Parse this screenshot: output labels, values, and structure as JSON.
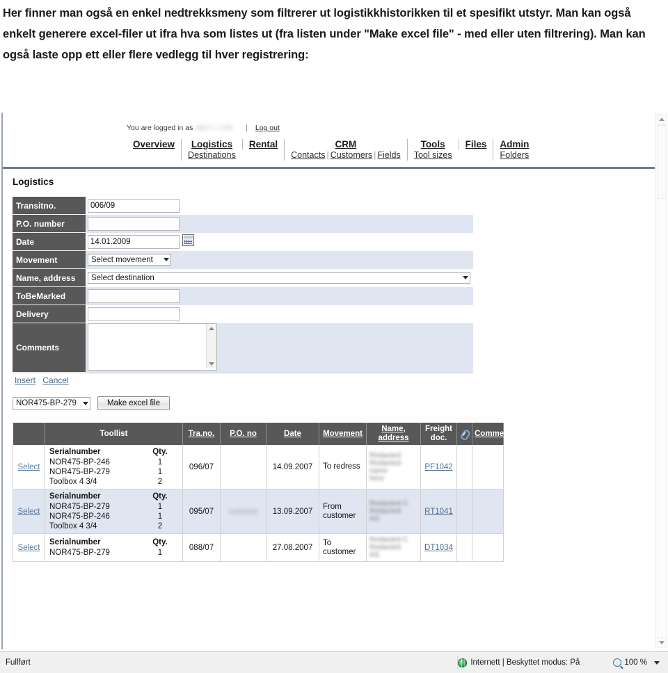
{
  "caption": {
    "text": "Her finner man også en enkel nedtrekksmeny som filtrerer ut logistikkhistorikken til et spesifikt utstyr. Man kan også enkelt generere excel-filer ut ifra hva som listes ut (fra listen under \"Make excel file\" - med eller uten filtrering). Man kan også laste opp ett eller flere vedlegg til hver registrering:"
  },
  "login": {
    "text": "You are logged in as",
    "separator": "|",
    "logout_label": "Log out"
  },
  "nav": [
    {
      "primary": "Overview",
      "sub": []
    },
    {
      "primary": "Logistics",
      "sub": [
        "Destinations"
      ]
    },
    {
      "primary": "Rental",
      "sub": []
    },
    {
      "primary": "CRM",
      "sub": [
        "Contacts",
        "Customers",
        "Fields"
      ]
    },
    {
      "primary": "Tools",
      "sub": [
        "Tool sizes"
      ]
    },
    {
      "primary": "Files",
      "sub": []
    },
    {
      "primary": "Admin",
      "sub": [
        "Folders"
      ]
    }
  ],
  "page": {
    "title": "Logistics"
  },
  "form": {
    "rows": [
      {
        "label": "Transitno.",
        "type": "text",
        "value": "006/09",
        "placeholder": ""
      },
      {
        "label": "P.O. number",
        "type": "text",
        "value": "",
        "placeholder": ""
      },
      {
        "label": "Date",
        "type": "date",
        "value": "14.01.2009",
        "placeholder": ""
      },
      {
        "label": "Movement",
        "type": "select",
        "value": "Select movement",
        "placeholder": ""
      },
      {
        "label": "Name, address",
        "type": "select",
        "value": "Select destination",
        "placeholder": ""
      },
      {
        "label": "ToBeMarked",
        "type": "text",
        "value": "",
        "placeholder": ""
      },
      {
        "label": "Delivery",
        "type": "text",
        "value": "",
        "placeholder": ""
      },
      {
        "label": "Comments",
        "type": "textarea",
        "value": "",
        "placeholder": ""
      }
    ],
    "insert_label": "Insert",
    "cancel_label": "Cancel"
  },
  "export": {
    "equipment_selected": "NOR475-BP-279",
    "make_excel_label": "Make excel file"
  },
  "grid": {
    "columns": [
      {
        "label": "",
        "sortable": false,
        "icon": ""
      },
      {
        "label": "Toollist",
        "sortable": false,
        "icon": ""
      },
      {
        "label": "Tra.no.",
        "sortable": true,
        "icon": ""
      },
      {
        "label": "P.O. no",
        "sortable": true,
        "icon": ""
      },
      {
        "label": "Date",
        "sortable": true,
        "icon": ""
      },
      {
        "label": "Movement",
        "sortable": true,
        "icon": ""
      },
      {
        "label": "Name, address",
        "sortable": true,
        "icon": ""
      },
      {
        "label": "Freight doc.",
        "sortable": false,
        "icon": ""
      },
      {
        "label": "",
        "sortable": false,
        "icon": "paperclip-icon"
      },
      {
        "label": "Comments",
        "sortable": true,
        "icon": ""
      }
    ],
    "toollist_headers": {
      "serial": "Serialnumber",
      "qty": "Qty."
    },
    "select_label": "Select",
    "rows": [
      {
        "select": "Select",
        "tools": [
          {
            "serial": "NOR475-BP-246",
            "qty": "1"
          },
          {
            "serial": "NOR475-BP-279",
            "qty": "1"
          },
          {
            "serial": "Toolbox 4 3/4",
            "qty": "2"
          }
        ],
        "transit_no": "096/07",
        "po_no": "",
        "po_redacted": false,
        "date": "14.09.2007",
        "movement": "To redress",
        "name_address": "Redacted\nRedacted name\nhere",
        "name_redacted": true,
        "freight_doc": "PF1042",
        "attachment": "",
        "comments": ""
      },
      {
        "select": "Select",
        "tools": [
          {
            "serial": "NOR475-BP-279",
            "qty": "1"
          },
          {
            "serial": "NOR475-BP-246",
            "qty": "1"
          },
          {
            "serial": "Toolbox 4 3/4",
            "qty": "2"
          }
        ],
        "transit_no": "095/07",
        "po_no": "redacted",
        "po_redacted": true,
        "date": "13.09.2007",
        "movement": "From customer",
        "name_address": "Redacted C\nRedacted\nAS",
        "name_redacted": true,
        "freight_doc": "RT1041",
        "attachment": "",
        "comments": ""
      },
      {
        "select": "Select",
        "tools": [
          {
            "serial": "NOR475-BP-279",
            "qty": "1"
          }
        ],
        "transit_no": "088/07",
        "po_no": "",
        "po_redacted": false,
        "date": "27.08.2007",
        "movement": "To customer",
        "name_address": "Redacted C\nRedacted\nAS",
        "name_redacted": true,
        "freight_doc": "DT1034",
        "attachment": "",
        "comments": ""
      }
    ]
  },
  "statusbar": {
    "status_text": "Fullført",
    "zone_text": "Internett | Beskyttet modus: På",
    "zoom_level": "100 %"
  }
}
